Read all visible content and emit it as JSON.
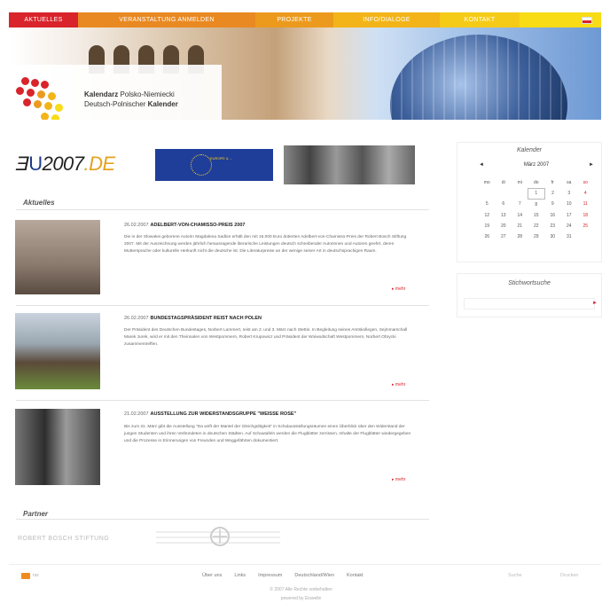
{
  "nav": {
    "items": [
      "AKTUELLES",
      "VERANSTALTUNG ANMELDEN",
      "PROJEKTE",
      "INFO/DIALOGE",
      "KONTAKT"
    ]
  },
  "header": {
    "logo_line1_prefix": "Kalendarz",
    "logo_line1_suffix": " Polsko-Niemiecki",
    "logo_line2_prefix": "Deutsch-Polnischer ",
    "logo_line2_suffix": "Kalender"
  },
  "logos": {
    "eu2007_prefix": "Ǝ",
    "eu2007_u": "U",
    "eu2007_num": "2007",
    "eu2007_de": ".DE",
    "eu_flag_caption": "EUROPE & ..."
  },
  "sections": {
    "news_title": "Aktuelles",
    "partner_title": "Partner"
  },
  "news": [
    {
      "date": "26.02.2007",
      "title": "ADELBERT-VON-CHAMISSO-PREIS 2007",
      "body": "Die in der Slowakei geborene Autorin Magdalena Sadlon erhält den mit 15.000 Euro dotierten Adelbert-von-Chamisso-Preis der Robert Bosch Stiftung 2007. Mit der Auszeichnung werden jährlich herausragende literarische Leistungen deutsch schreibender Autorinnen und Autoren geehrt, deren Muttersprache oder kulturelle Herkunft nicht die deutsche ist. Die Literaturpreise an der wenige seiner Art in deutschsprachigen Raum.",
      "more": "mehr"
    },
    {
      "date": "26.02.2007",
      "title": "BUNDESTAGSPRÄSIDENT REIST NACH POLEN",
      "body": "Der Präsident des Deutschen Bundestages, Norbert Lammert, reist am 2. und 3. März nach Stettin. In Begleitung seines Amtskollegen, Sejmmarschall Marek Jurek, wird er mit den Theinnalen von Westpommern, Robert Krupowicz und Präsident der Woiwodschaft Westpommern, Norbert Obrycki zusammentreffen.",
      "more": "mehr"
    },
    {
      "date": "21.02.2007",
      "title": "AUSSTELLUNG ZUR WIDERSTANDSGRUPPE \"WEISSE ROSE\"",
      "body": "Bis zum 31. März gibt die Ausstellung \"Da wirft der Mantel der Gleichgültigkeit\" in Schulausstellungsräumen einen Überblick über den Widerstand der jungen Studenten und ihren Verbündeten in deutschen Städten. Auf Schautafeln werden die Flugblätter zerrissen, Inhalte der Flugblätter wiedergegeben und die Prozesse in Erinnerungen von Freunden und Weggefährten dokumentiert.",
      "more": "mehr"
    }
  ],
  "partners": {
    "p1": "ROBERT BOSCH STIFTUNG"
  },
  "calendar": {
    "title": "Kalender",
    "prev": "◄",
    "month": "März 2007",
    "next": "►",
    "weekdays": [
      "mo",
      "di",
      "mi",
      "do",
      "fr",
      "sa",
      "so"
    ],
    "weeks": [
      [
        "",
        "",
        "",
        "1",
        "2",
        "3",
        "4"
      ],
      [
        "5",
        "6",
        "7",
        "8",
        "9",
        "10",
        "11"
      ],
      [
        "12",
        "13",
        "14",
        "15",
        "16",
        "17",
        "18"
      ],
      [
        "19",
        "20",
        "21",
        "22",
        "23",
        "24",
        "25"
      ],
      [
        "26",
        "27",
        "28",
        "29",
        "30",
        "31",
        ""
      ]
    ]
  },
  "search": {
    "title": "Stichwortsuche",
    "placeholder": "",
    "go": "►"
  },
  "footer": {
    "rss": "rss",
    "links": [
      "Über uns",
      "Links",
      "Impressum",
      "Deutschland/Wien",
      "Kontakt"
    ],
    "right1": "Suche",
    "right2": "Drucken",
    "copyright_line1": "© 2007 Alle Rechte vorbehalten",
    "copyright_line2": "powered by Eiswelle"
  },
  "colors": {
    "nav_red": "#d8242a",
    "nav_orange": "#e98922",
    "nav_yellow": "#f7dc16",
    "eu_blue": "#1f3e9a"
  }
}
